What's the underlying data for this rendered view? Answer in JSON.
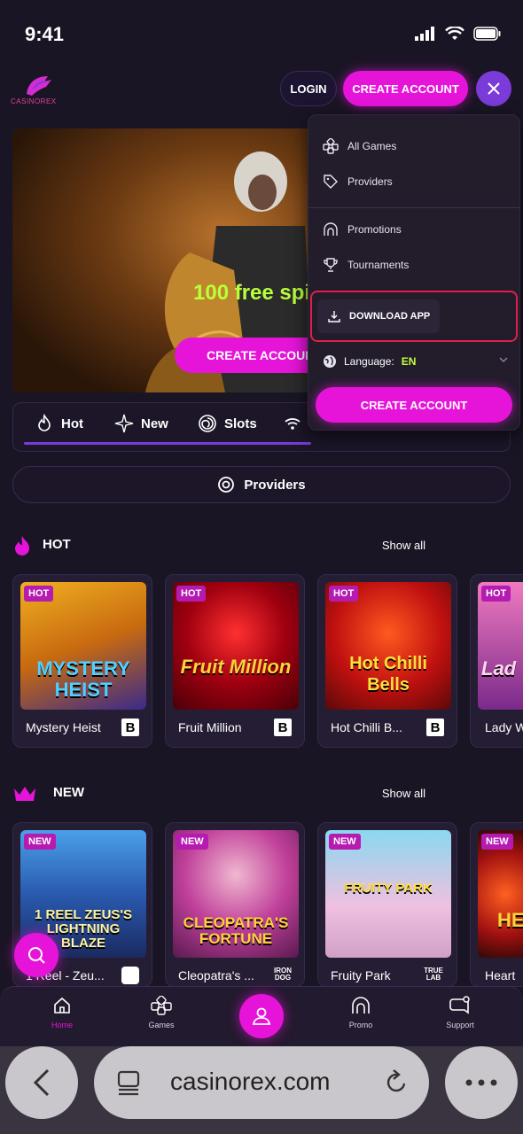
{
  "status": {
    "time": "9:41"
  },
  "header": {
    "logo_text": "CASINOREX",
    "login_label": "LOGIN",
    "create_account_label": "CREATE ACCOUNT"
  },
  "hero": {
    "promo_text": "100 free spi",
    "cta_label": "CREATE ACCOUN"
  },
  "categories": {
    "tabs": [
      {
        "label": "Hot",
        "icon": "fire-icon"
      },
      {
        "label": "New",
        "icon": "sparkle-icon"
      },
      {
        "label": "Slots",
        "icon": "spiral-icon"
      },
      {
        "label": "",
        "icon": "wifi-icon"
      }
    ]
  },
  "providers_button_label": "Providers",
  "sections": {
    "hot": {
      "title": "HOT",
      "show_all": "Show all",
      "games": [
        {
          "badge": "HOT",
          "title": "Mystery Heist",
          "art_text": "MYSTERY HEIST",
          "provider": "B"
        },
        {
          "badge": "HOT",
          "title": "Fruit Million",
          "art_text": "Fruit Million",
          "provider": "B"
        },
        {
          "badge": "HOT",
          "title": "Hot Chilli B...",
          "art_text": "Hot Chilli Bells",
          "provider": "B"
        },
        {
          "badge": "HOT",
          "title": "Lady W",
          "art_text": "Lad",
          "provider": ""
        }
      ]
    },
    "new": {
      "title": "NEW",
      "show_all": "Show all",
      "games": [
        {
          "badge": "NEW",
          "title": "1 Reel - Zeu...",
          "art_text": "1 REEL ZEUS'S LIGHTNING BLAZE",
          "provider": ""
        },
        {
          "badge": "NEW",
          "title": "Cleopatra's ...",
          "art_text": "CLEOPATRA'S FORTUNE",
          "provider": "IRON DOG"
        },
        {
          "badge": "NEW",
          "title": "Fruity Park",
          "art_text": "FRUITY PARK",
          "provider": "TRUE LAB"
        },
        {
          "badge": "NEW",
          "title": "Heart",
          "art_text": "HE",
          "provider": ""
        }
      ]
    }
  },
  "menu": {
    "items": [
      {
        "label": "All Games",
        "icon": "games-icon"
      },
      {
        "label": "Providers",
        "icon": "tag-icon"
      },
      {
        "label": "Promotions",
        "icon": "promo-icon"
      },
      {
        "label": "Tournaments",
        "icon": "trophy-icon"
      }
    ],
    "download_label": "DOWNLOAD APP",
    "language_label": "Language:",
    "language_code": "EN",
    "create_account_label": "CREATE ACCOUNT"
  },
  "bottom_nav": {
    "items": [
      {
        "label": "Home",
        "active": true
      },
      {
        "label": "Games",
        "active": false
      },
      {
        "label": "Promo",
        "active": false
      },
      {
        "label": "Support",
        "active": false
      }
    ]
  },
  "browser": {
    "url": "casinorex.com"
  },
  "colors": {
    "accent": "#e614d9",
    "purple": "#7a3bd8",
    "lime": "#c6ff3b",
    "background": "#1a1524"
  }
}
